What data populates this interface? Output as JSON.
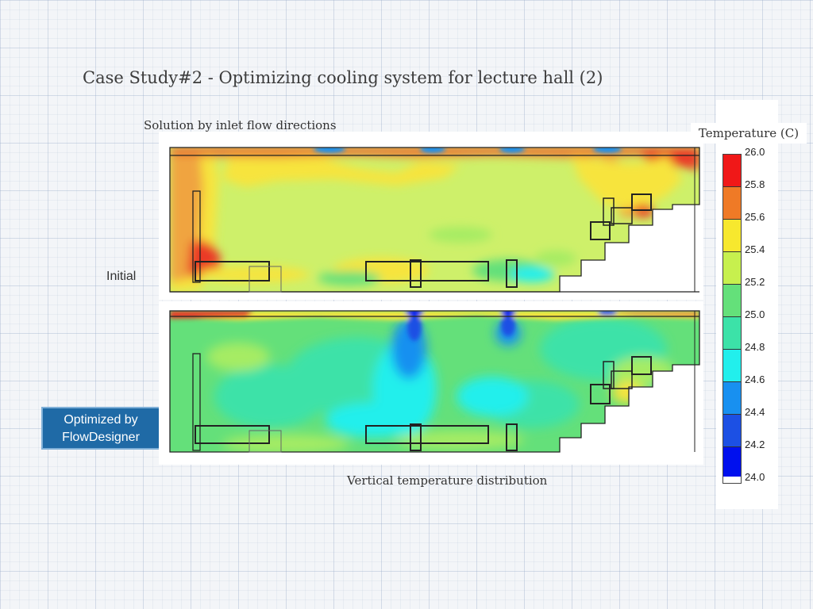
{
  "title": "Case Study#2  - Optimizing cooling system for lecture hall (2)",
  "subtitle": "Solution by inlet flow directions",
  "caption": "Vertical temperature distribution",
  "labels": {
    "initial": "Initial",
    "optimized": "Optimized by FlowDesigner"
  },
  "colorbar": {
    "title": "Temperature (C)",
    "ticks": [
      "26.0",
      "25.8",
      "25.6",
      "25.4",
      "25.2",
      "25.0",
      "24.8",
      "24.6",
      "24.4",
      "24.2",
      "24.0"
    ],
    "colors": [
      "#f01818",
      "#ef7a26",
      "#f7e82e",
      "#c7f04e",
      "#64e07a",
      "#3ce2a8",
      "#22efec",
      "#1890f0",
      "#1c50e4",
      "#0010ee"
    ]
  }
}
